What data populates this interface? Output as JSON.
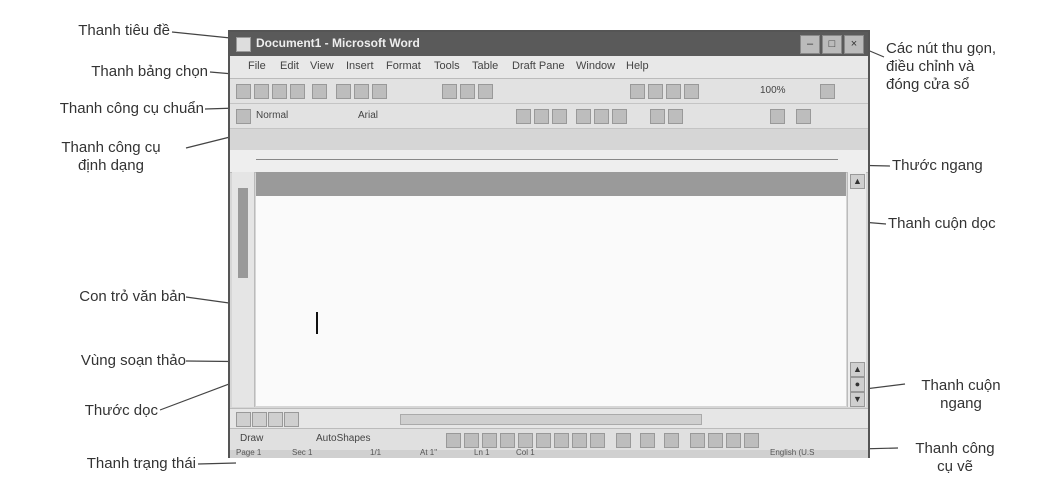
{
  "labels": {
    "title_bar": "Thanh tiêu đề",
    "menu_bar": "Thanh bảng chọn",
    "standard_toolbar": "Thanh công cụ chuẩn",
    "formatting_toolbar": "Thanh công cụ\nđịnh dạng",
    "text_cursor": "Con trỏ văn bản",
    "editing_area": "Vùng soạn thảo",
    "vertical_ruler": "Thước dọc",
    "status_bar": "Thanh trạng thái",
    "window_buttons": "Các nút thu gọn,\nđiều chỉnh và\nđóng cửa sổ",
    "horizontal_ruler": "Thước ngang",
    "vertical_scrollbar": "Thanh cuộn dọc",
    "horizontal_scrollbar": "Thanh cuộn\nngang",
    "drawing_toolbar": "Thanh công\ncụ vẽ"
  },
  "window": {
    "title": "Document1 - Microsoft Word",
    "menus": [
      "File",
      "Edit",
      "View",
      "Insert",
      "Format",
      "Tools",
      "Table",
      "Draft Pane",
      "Window",
      "Help"
    ],
    "style_box": "Normal",
    "font_box": "Arial",
    "zoom": "100%",
    "draw_menu": "Draw",
    "autoshapes_menu": "AutoShapes",
    "status": [
      "Page 1",
      "Sec 1",
      "1/1",
      "At 1\"",
      "Ln 1",
      "Col 1",
      "English (U.S"
    ]
  }
}
